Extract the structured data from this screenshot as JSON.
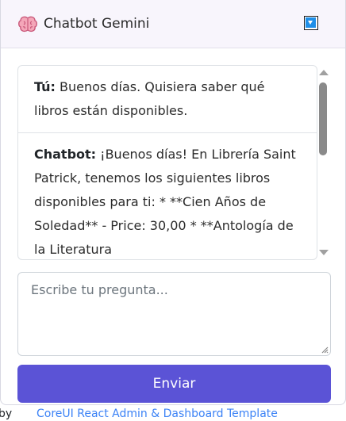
{
  "header": {
    "title": "Chatbot Gemini",
    "brain_icon": "brain-icon",
    "toggle_icon": "chevron-down-icon"
  },
  "background": {
    "footer_prefix": "by",
    "footer_link": "CoreUI React Admin & Dashboard Template"
  },
  "messages": [
    {
      "who": "Tú:",
      "text": " Buenos días. Quisiera saber qué libros están disponibles."
    },
    {
      "who": "Chatbot:",
      "text": " ¡Buenos días! En Librería Saint Patrick, tenemos los siguientes libros disponibles para ti: * **Cien Años de Soledad** - Price: 30,00 * **Antología de la Literatura"
    }
  ],
  "input": {
    "placeholder": "Escribe tu pregunta..."
  },
  "send_label": "Enviar",
  "colors": {
    "accent": "#5b53d6",
    "header_bg": "#f8f5fc",
    "toggle_blue": "#1f8fe8"
  }
}
